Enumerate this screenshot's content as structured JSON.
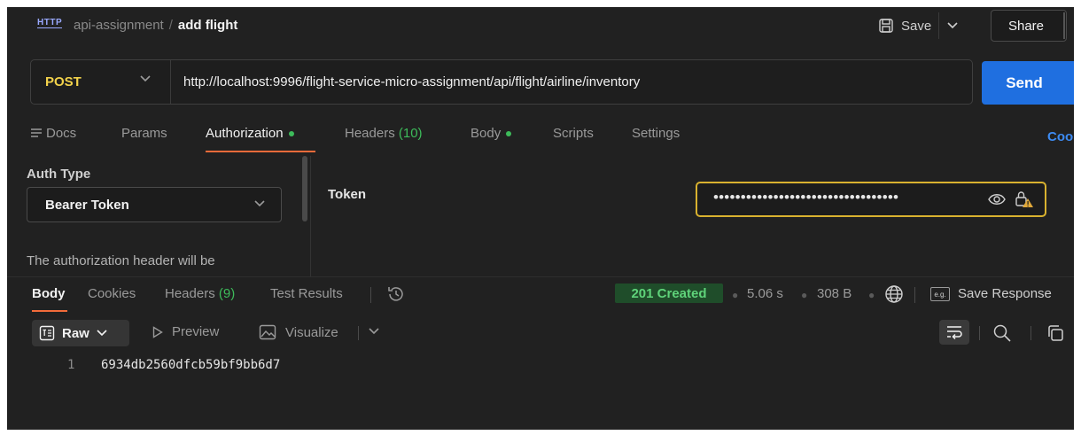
{
  "header": {
    "protocol_badge": "HTTP",
    "collection": "api-assignment",
    "separator": "/",
    "request_name": "add flight",
    "save_label": "Save",
    "share_label": "Share"
  },
  "request": {
    "method": "POST",
    "url": "http://localhost:9996/flight-service-micro-assignment/api/flight/airline/inventory",
    "send_label": "Send"
  },
  "request_tabs": {
    "docs": "Docs",
    "params": "Params",
    "authorization": "Authorization",
    "headers": "Headers",
    "headers_count": "(10)",
    "body": "Body",
    "scripts": "Scripts",
    "settings": "Settings",
    "cookies": "Coo"
  },
  "auth": {
    "type_label": "Auth Type",
    "type_value": "Bearer Token",
    "note": "The authorization header will be",
    "token_label": "Token",
    "token_masked": "••••••••••••••••••••••••••••••••••"
  },
  "response": {
    "tabs": {
      "body": "Body",
      "cookies": "Cookies",
      "headers": "Headers",
      "headers_count": "(9)",
      "test_results": "Test Results"
    },
    "status": "201 Created",
    "time": "5.06 s",
    "size": "308 B",
    "save_response": "Save Response",
    "format": "Raw",
    "preview": "Preview",
    "visualize": "Visualize",
    "lines": [
      {
        "number": "1",
        "text": "6934db2560dfcb59bf9bb6d7"
      }
    ]
  },
  "colors": {
    "accent_orange": "#f26b3a",
    "send_blue": "#1f6fe0",
    "method_yellow": "#f2d24b",
    "success_green": "#3dbb5a"
  }
}
